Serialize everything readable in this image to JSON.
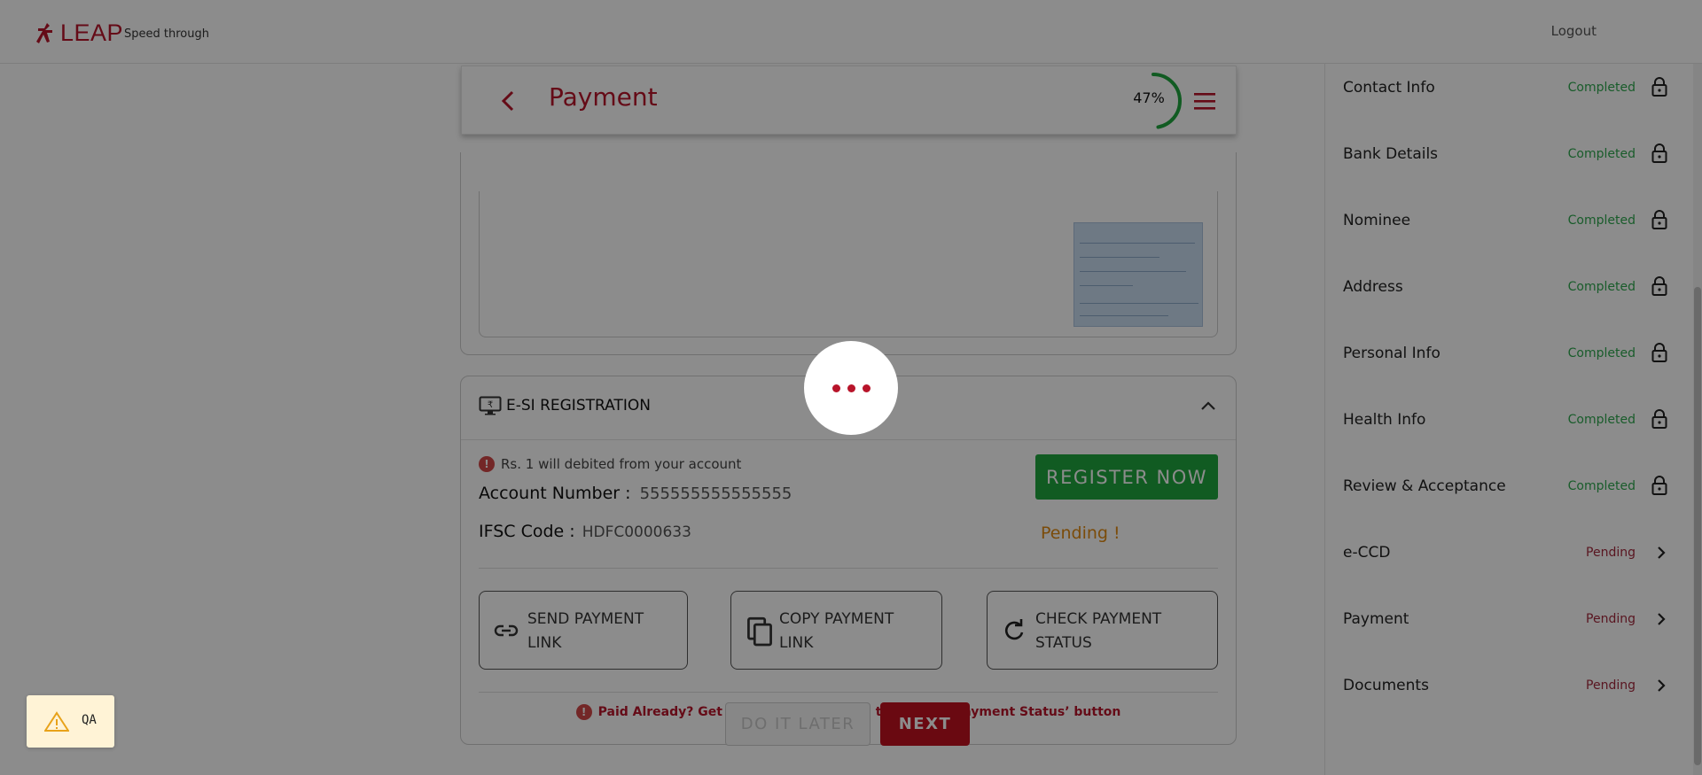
{
  "header": {
    "logo_text": "LEAP",
    "tagline": "Speed through",
    "logout_label": "Logout"
  },
  "payment_header": {
    "title": "Payment",
    "progress_text": "47%",
    "progress_value": 0.47
  },
  "esi": {
    "title": "E-SI REGISTRATION",
    "debit_info": "Rs. 1 will debited from your account",
    "account_label": "Account Number :",
    "account_value": "555555555555555",
    "ifsc_label": "IFSC Code :",
    "ifsc_value": "HDFC0000633",
    "register_label": "REGISTER NOW",
    "status_text": "Pending !",
    "send_link_label": "SEND PAYMENT\nLINK",
    "copy_link_label": "COPY PAYMENT\nLINK",
    "check_status_label": "CHECK PAYMENT\nSTATUS",
    "paid_note": "Paid Already? Get status by clicking on the ‘Check Payment Status’ button"
  },
  "footer": {
    "later_label": "DO IT LATER",
    "next_label": "NEXT"
  },
  "sidebar": {
    "steps": [
      {
        "name": "Contact Info",
        "status": "Completed"
      },
      {
        "name": "Bank Details",
        "status": "Completed"
      },
      {
        "name": "Nominee",
        "status": "Completed"
      },
      {
        "name": "Address",
        "status": "Completed"
      },
      {
        "name": "Personal Info",
        "status": "Completed"
      },
      {
        "name": "Health Info",
        "status": "Completed"
      },
      {
        "name": "Review & Acceptance",
        "status": "Completed"
      },
      {
        "name": "e-CCD",
        "status": "Pending"
      },
      {
        "name": "Payment",
        "status": "Pending"
      },
      {
        "name": "Documents",
        "status": "Pending"
      }
    ]
  },
  "qa_badge": {
    "label": "QA"
  },
  "colors": {
    "brand": "#b8142a",
    "success": "#1fa63e",
    "warning": "#e08a13"
  }
}
